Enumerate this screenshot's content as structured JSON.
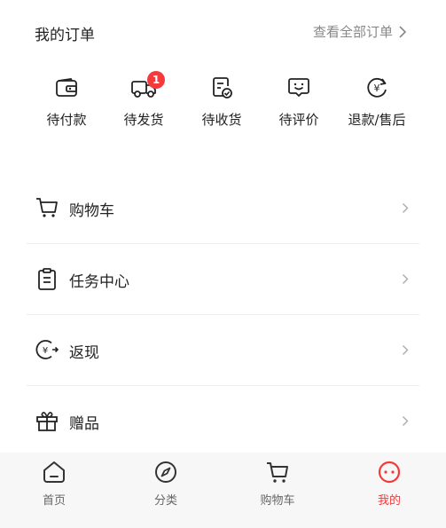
{
  "orders": {
    "title": "我的订单",
    "view_all": "查看全部订单"
  },
  "order_status": [
    {
      "label": "待付款",
      "icon": "wallet-icon"
    },
    {
      "label": "待发货",
      "icon": "truck-icon",
      "badge": "1"
    },
    {
      "label": "待收货",
      "icon": "receipt-check-icon"
    },
    {
      "label": "待评价",
      "icon": "smile-chat-icon"
    },
    {
      "label": "退款/售后",
      "icon": "yuan-refresh-icon"
    }
  ],
  "menu": [
    {
      "label": "购物车",
      "icon": "cart-icon"
    },
    {
      "label": "任务中心",
      "icon": "clipboard-icon"
    },
    {
      "label": "返现",
      "icon": "yuan-arrow-icon"
    },
    {
      "label": "赠品",
      "icon": "gift-icon"
    }
  ],
  "bottom_nav": [
    {
      "label": "首页",
      "icon": "home-icon"
    },
    {
      "label": "分类",
      "icon": "compass-icon"
    },
    {
      "label": "购物车",
      "icon": "cart-icon"
    },
    {
      "label": "我的",
      "icon": "face-icon",
      "active": true
    }
  ],
  "colors": {
    "accent": "#f43a3a",
    "text": "#222222",
    "muted": "#888888",
    "divider": "#ececec",
    "nav_bg": "#f7f7f7"
  }
}
